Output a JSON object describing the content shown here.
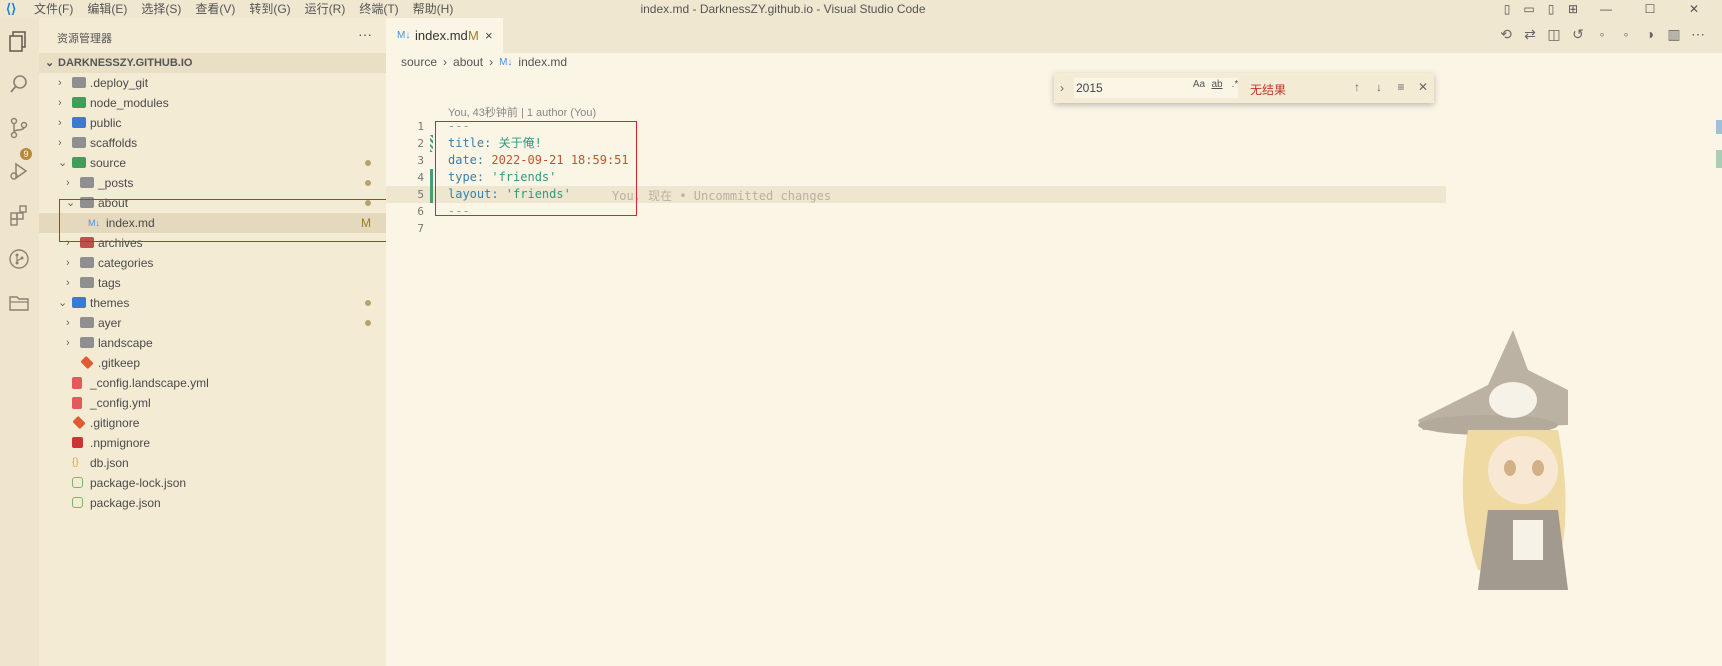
{
  "window": {
    "title": "index.md - DarknessZY.github.io - Visual Studio Code",
    "menu": [
      "文件(F)",
      "编辑(E)",
      "选择(S)",
      "查看(V)",
      "转到(G)",
      "运行(R)",
      "终端(T)",
      "帮助(H)"
    ]
  },
  "activity_bar": {
    "scm_badge": "9"
  },
  "explorer": {
    "header": "资源管理器",
    "more": "···",
    "root": "DARKNESSZY.GITHUB.IO",
    "items": [
      {
        "label": ".deploy_git",
        "chev": "›",
        "icon": "folder-grey"
      },
      {
        "label": "node_modules",
        "chev": "›",
        "icon": "folder-green"
      },
      {
        "label": "public",
        "chev": "›",
        "icon": "folder-blue"
      },
      {
        "label": "scaffolds",
        "chev": "›",
        "icon": "folder-grey"
      },
      {
        "label": "source",
        "chev": "⌄",
        "icon": "folder-green"
      },
      {
        "label": "_posts",
        "chev": "›",
        "icon": "folder-grey"
      },
      {
        "label": "about",
        "chev": "⌄",
        "icon": "folder-grey"
      },
      {
        "label": "index.md",
        "chev": "",
        "icon": "markdown",
        "mark": "M"
      },
      {
        "label": "archives",
        "chev": "›",
        "icon": "folder-red"
      },
      {
        "label": "categories",
        "chev": "›",
        "icon": "folder-grey"
      },
      {
        "label": "tags",
        "chev": "›",
        "icon": "folder-grey"
      },
      {
        "label": "themes",
        "chev": "⌄",
        "icon": "folder-blue"
      },
      {
        "label": "ayer",
        "chev": "›",
        "icon": "folder-grey"
      },
      {
        "label": "landscape",
        "chev": "›",
        "icon": "folder-grey"
      },
      {
        "label": ".gitkeep",
        "chev": "",
        "icon": "git"
      },
      {
        "label": "_config.landscape.yml",
        "chev": "",
        "icon": "yml"
      },
      {
        "label": "_config.yml",
        "chev": "",
        "icon": "yml"
      },
      {
        "label": ".gitignore",
        "chev": "",
        "icon": "git"
      },
      {
        "label": ".npmignore",
        "chev": "",
        "icon": "npm"
      },
      {
        "label": "db.json",
        "chev": "",
        "icon": "json"
      },
      {
        "label": "package-lock.json",
        "chev": "",
        "icon": "node"
      },
      {
        "label": "package.json",
        "chev": "",
        "icon": "node"
      }
    ]
  },
  "editor": {
    "tab": {
      "label": "index.md",
      "modified": "M",
      "close": "×"
    },
    "breadcrumb": [
      "source",
      "about",
      "index.md"
    ],
    "codelens": "You, 43秒钟前 | 1 author (You)",
    "line_numbers": [
      "1",
      "2",
      "3",
      "4",
      "5",
      "6",
      "7"
    ],
    "lines": [
      {
        "key": "---",
        "val": ""
      },
      {
        "key": "title:",
        "val": " 关于俺!"
      },
      {
        "key": "date:",
        "val": " 2022-09-21 18:59:51"
      },
      {
        "key": "type:",
        "val": " 'friends'"
      },
      {
        "key": "layout:",
        "val": " 'friends'"
      },
      {
        "key": "---",
        "val": ""
      },
      {
        "key": "",
        "val": ""
      }
    ],
    "blame": "You, 现在 • Uncommitted changes"
  },
  "find": {
    "value": "2015",
    "case_label": "Aa",
    "word_label": "ab",
    "regex_label": ".*",
    "result": "无结果"
  },
  "colors": {
    "accent": "#1e7fd6",
    "selection_box": "#dd2233",
    "modified": "#a07a30",
    "git_bar": "#4c9a7a"
  }
}
